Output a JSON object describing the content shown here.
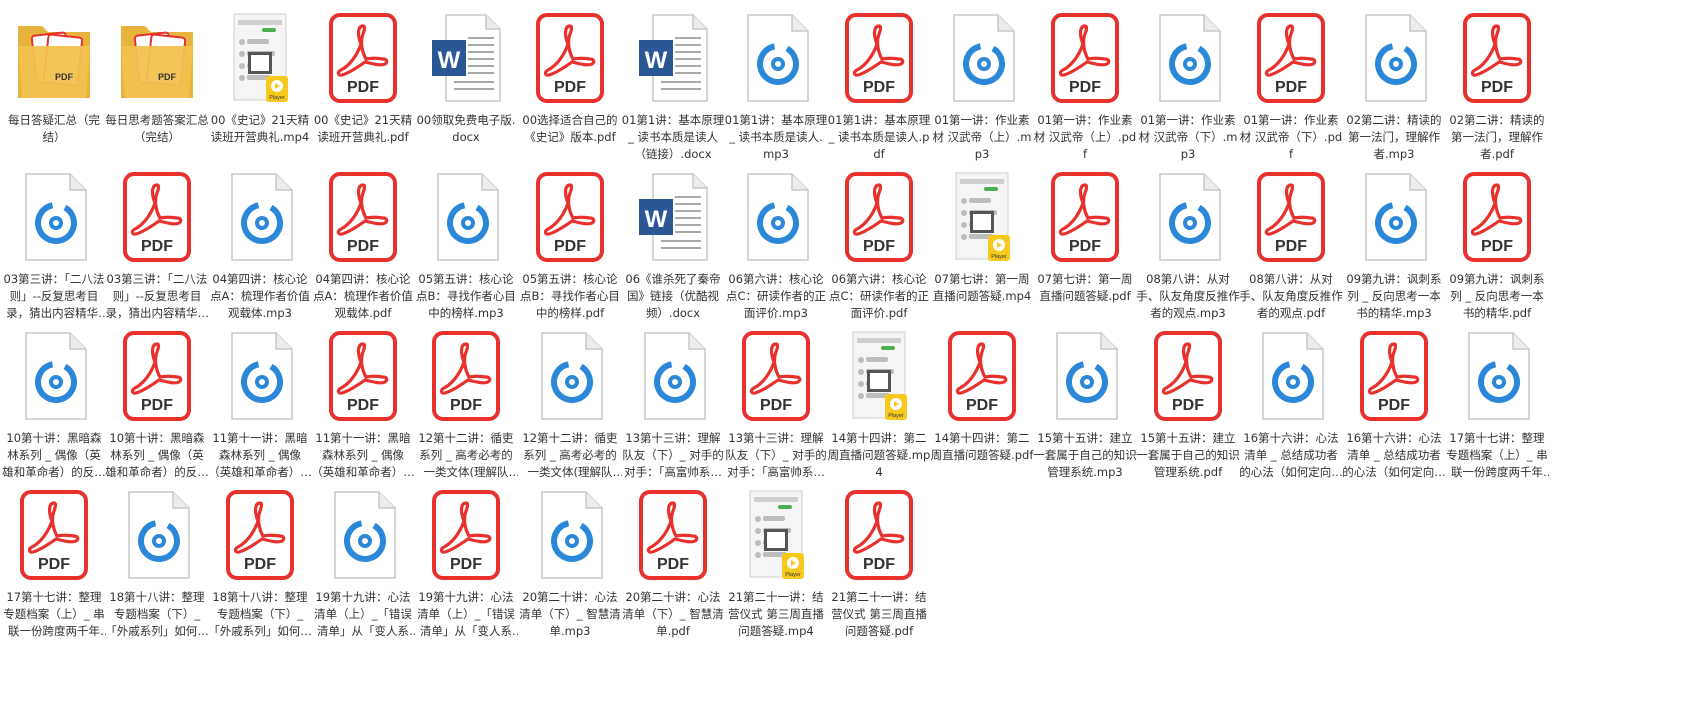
{
  "colors": {
    "pdf": "#e8302c",
    "audio": "#2b87d8",
    "word": "#2b5797",
    "folder": "#f2c14e",
    "player": "#f7c81d",
    "text": "#333333"
  },
  "icon_labels": {
    "pdf": "PDF",
    "word": "W",
    "folder_pdf": "PDF",
    "player": "Player"
  },
  "files": [
    {
      "type": "folder",
      "name": "每日答疑汇总（完结）"
    },
    {
      "type": "folder",
      "name": "每日思考题答案汇总（完结）"
    },
    {
      "type": "video",
      "name": "00《史记》21天精读班开营典礼.mp4"
    },
    {
      "type": "pdf",
      "name": "00《史记》21天精读班开营典礼.pdf"
    },
    {
      "type": "word",
      "name": "00领取免费电子版.docx"
    },
    {
      "type": "pdf",
      "name": "00选择适合自己的《史记》版本.pdf"
    },
    {
      "type": "word",
      "name": "01第1讲：基本原理 _ 读书本质是读人（链接）.docx"
    },
    {
      "type": "audio",
      "name": "01第1讲：基本原理 _ 读书本质是读人.mp3"
    },
    {
      "type": "pdf",
      "name": "01第1讲：基本原理 _ 读书本质是读人.pdf"
    },
    {
      "type": "audio",
      "name": "01第一讲：作业素材 汉武帝（上）.mp3"
    },
    {
      "type": "pdf",
      "name": "01第一讲：作业素材 汉武帝（上）.pdf"
    },
    {
      "type": "audio",
      "name": "01第一讲：作业素材 汉武帝（下）.mp3"
    },
    {
      "type": "pdf",
      "name": "01第一讲：作业素材 汉武帝（下）.pdf"
    },
    {
      "type": "audio",
      "name": "02第二讲：精读的第一法门，理解作者.mp3"
    },
    {
      "type": "pdf",
      "name": "02第二讲：精读的第一法门，理解作者.pdf"
    },
    {
      "type": "audio",
      "name": "03第三讲：「二八法则」--反复思考目录，猜出内容精华.mp3"
    },
    {
      "type": "pdf",
      "name": "03第三讲：「二八法则」--反复思考目录，猜出内容精华.pdf"
    },
    {
      "type": "audio",
      "name": "04第四讲：核心论点A：梳理作者价值观载体.mp3"
    },
    {
      "type": "pdf",
      "name": "04第四讲：核心论点A：梳理作者价值观载体.pdf"
    },
    {
      "type": "audio",
      "name": "05第五讲：核心论点B：寻找作者心目中的榜样.mp3"
    },
    {
      "type": "pdf",
      "name": "05第五讲：核心论点B：寻找作者心目中的榜样.pdf"
    },
    {
      "type": "word",
      "name": "06《谁杀死了秦帝国》链接（优酷视频）.docx"
    },
    {
      "type": "audio",
      "name": "06第六讲：核心论点C：研读作者的正面评价.mp3"
    },
    {
      "type": "pdf",
      "name": "06第六讲：核心论点C：研读作者的正面评价.pdf"
    },
    {
      "type": "video",
      "name": "07第七讲：第一周直播问题答疑.mp4"
    },
    {
      "type": "pdf",
      "name": "07第七讲：第一周直播问题答疑.pdf"
    },
    {
      "type": "audio",
      "name": "08第八讲：从对手、队友角度反推作者的观点.mp3"
    },
    {
      "type": "pdf",
      "name": "08第八讲：从对手、队友角度反推作者的观点.pdf"
    },
    {
      "type": "audio",
      "name": "09第九讲：讽刺系列 _ 反向思考一本书的精华.mp3"
    },
    {
      "type": "pdf",
      "name": "09第九讲：讽刺系列 _ 反向思考一本书的精华.pdf"
    },
    {
      "type": "audio",
      "name": "10第十讲：黑暗森林系列 _ 偶像（英雄和革命者）的反面（..."
    },
    {
      "type": "pdf",
      "name": "10第十讲：黑暗森林系列 _ 偶像（英雄和革命者）的反面（..."
    },
    {
      "type": "audio",
      "name": "11第十一讲：黑暗森林系列 _ 偶像（英雄和革命者）的反面（..."
    },
    {
      "type": "pdf",
      "name": "11第十一讲：黑暗森林系列 _ 偶像（英雄和革命者）的反面（..."
    },
    {
      "type": "pdf",
      "name": "12第十二讲：循吏系列 _ 高考必考的一类文体(理解队友）.pdf"
    },
    {
      "type": "audio",
      "name": "12第十二讲：循吏系列 _ 高考必考的一类文体(理解队友）.mp3"
    },
    {
      "type": "audio",
      "name": "13第十三讲：理解队友（下）_ 对手的对手：「高富帅系列+..."
    },
    {
      "type": "pdf",
      "name": "13第十三讲：理解队友（下）_ 对手的对手：「高富帅系列+..."
    },
    {
      "type": "video",
      "name": "14第十四讲：第二周直播问题答疑.mp4"
    },
    {
      "type": "pdf",
      "name": "14第十四讲：第二周直播问题答疑.pdf"
    },
    {
      "type": "audio",
      "name": "15第十五讲：建立一套属于自己的知识管理系统.mp3"
    },
    {
      "type": "pdf",
      "name": "15第十五讲：建立一套属于自己的知识管理系统.pdf"
    },
    {
      "type": "audio",
      "name": "16第十六讲：心法清单 _ 总结成功者的心法（如何定向积累素..."
    },
    {
      "type": "pdf",
      "name": "16第十六讲：心法清单 _ 总结成功者的心法（如何定向积累素..."
    },
    {
      "type": "audio",
      "name": "17第十七讲：整理专题档案（上）_ 串联一份跨度两千年的..."
    },
    {
      "type": "pdf",
      "name": "17第十七讲：整理专题档案（上）_ 串联一份跨度两千年的..."
    },
    {
      "type": "audio",
      "name": "18第十八讲：整理专题档案（下）_「外戚系列」如何使用..."
    },
    {
      "type": "pdf",
      "name": "18第十八讲：整理专题档案（下）_「外戚系列」如何使用..."
    },
    {
      "type": "audio",
      "name": "19第十九讲：心法清单（上）_「错误清单」从「变人系列」看..."
    },
    {
      "type": "pdf",
      "name": "19第十九讲：心法清单（上）_「错误清单」从「变人系列」看..."
    },
    {
      "type": "audio",
      "name": "20第二十讲：心法清单（下）_ 智慧清单.mp3"
    },
    {
      "type": "pdf",
      "name": "20第二十讲：心法清单（下）_ 智慧清单.pdf"
    },
    {
      "type": "video",
      "name": "21第二十一讲：结营仪式 第三周直播问题答疑.mp4"
    },
    {
      "type": "pdf",
      "name": "21第二十一讲：结营仪式 第三周直播问题答疑.pdf"
    }
  ]
}
